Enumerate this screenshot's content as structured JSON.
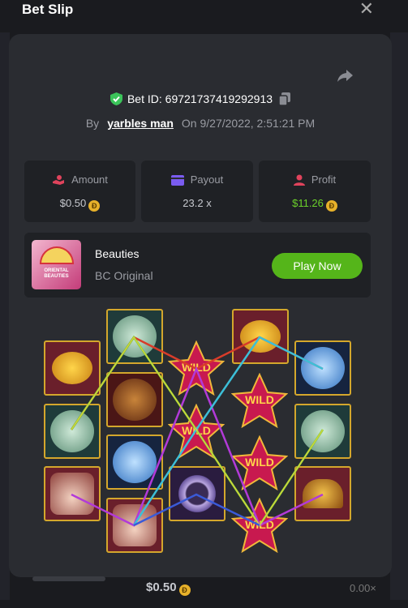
{
  "header": {
    "title": "Bet Slip",
    "close_glyph": "✕"
  },
  "bet": {
    "id_label": "Bet ID: 69721737419292913",
    "by_label": "By",
    "user": "yarbles man",
    "on_label": "On",
    "datetime": "9/27/2022, 2:51:21 PM"
  },
  "stats": {
    "amount": {
      "label": "Amount",
      "value": "$0.50"
    },
    "payout": {
      "label": "Payout",
      "value": "23.2 x"
    },
    "profit": {
      "label": "Profit",
      "value": "$11.26"
    }
  },
  "coin_glyph": "Ð",
  "game": {
    "name": "Beauties",
    "provider": "BC Original",
    "play_label": "Play Now",
    "thumb_text": "ORIENTAL BEAUTIES"
  },
  "wild_text": "WILD",
  "footer": {
    "amount": "$0.50",
    "multiplier": "0.00×"
  },
  "colors": {
    "accent_green": "#55b51a",
    "profit_green": "#6bd12a",
    "gold": "#d4a72c",
    "panel": "#2a2c31"
  }
}
